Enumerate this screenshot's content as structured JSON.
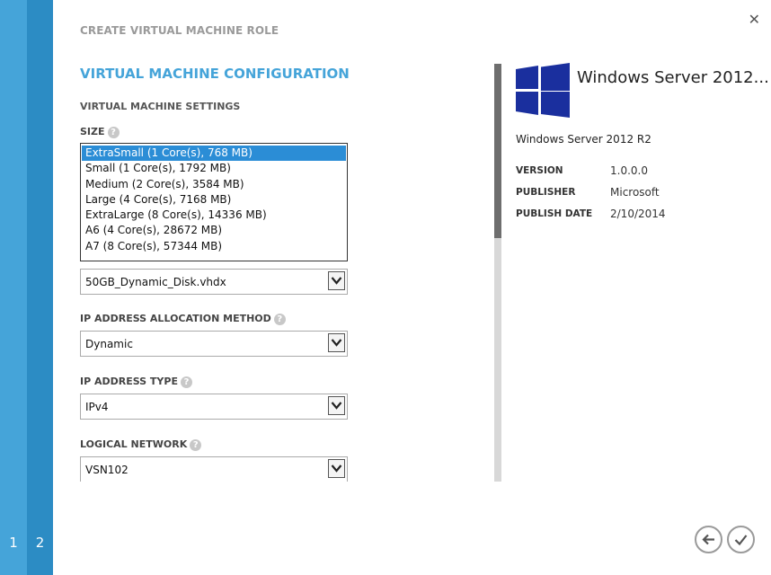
{
  "wizard": {
    "title": "CREATE VIRTUAL MACHINE ROLE",
    "section_title": "VIRTUAL MACHINE CONFIGURATION",
    "group_title": "VIRTUAL MACHINE SETTINGS",
    "steps": [
      "1",
      "2"
    ],
    "close_glyph": "✕"
  },
  "size": {
    "label": "SIZE",
    "help": "?",
    "options": [
      "ExtraSmall (1 Core(s), 768 MB)",
      "Small (1 Core(s), 1792 MB)",
      "Medium (2 Core(s), 3584 MB)",
      "Large (4 Core(s), 7168 MB)",
      "ExtraLarge (8 Core(s), 14336 MB)",
      "A6 (4 Core(s), 28672 MB)",
      "A7 (8 Core(s), 57344 MB)"
    ],
    "selected_index": 0
  },
  "disk": {
    "value": "50GB_Dynamic_Disk.vhdx"
  },
  "ip_allocation": {
    "label": "IP ADDRESS ALLOCATION METHOD",
    "help": "?",
    "value": "Dynamic"
  },
  "ip_type": {
    "label": "IP ADDRESS TYPE",
    "help": "?",
    "value": "IPv4"
  },
  "logical_network": {
    "label": "LOGICAL NETWORK",
    "help": "?",
    "value": "VSN102"
  },
  "details": {
    "title": "Windows Server 2012...",
    "full_name": "Windows Server 2012 R2",
    "version_label": "VERSION",
    "version": "1.0.0.0",
    "publisher_label": "PUBLISHER",
    "publisher": "Microsoft",
    "publish_date_label": "PUBLISH DATE",
    "publish_date": "2/10/2014"
  },
  "colors": {
    "accent": "#45a4d9",
    "rail_dark": "#2c8cc4",
    "selection": "#2b8dd6",
    "windows_logo": "#1a2f9e"
  },
  "icons": {
    "back": "back-arrow-icon",
    "finish": "checkmark-icon",
    "close": "close-icon",
    "help": "question-mark-icon",
    "logo": "windows-logo-icon"
  }
}
